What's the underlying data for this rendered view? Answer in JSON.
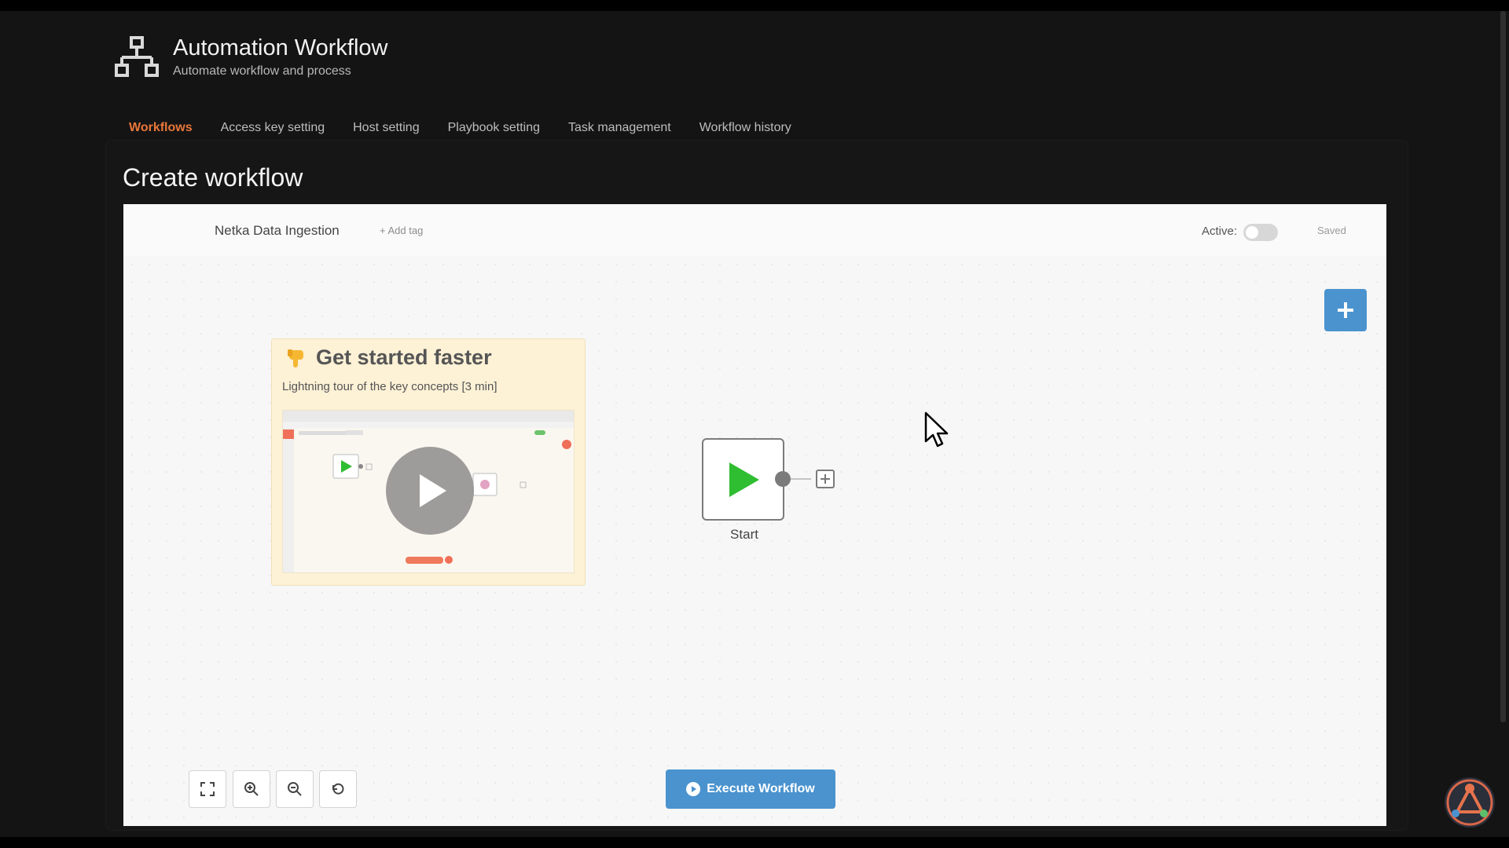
{
  "app": {
    "title": "Automation Workflow",
    "subtitle": "Automate workflow and process"
  },
  "tabs": [
    {
      "label": "Workflows",
      "active": true
    },
    {
      "label": "Access key setting",
      "active": false
    },
    {
      "label": "Host setting",
      "active": false
    },
    {
      "label": "Playbook setting",
      "active": false
    },
    {
      "label": "Task management",
      "active": false
    },
    {
      "label": "Workflow history",
      "active": false
    }
  ],
  "page": {
    "title": "Create workflow"
  },
  "editor": {
    "workflow_name": "Netka Data Ingestion",
    "add_tag": "+ Add tag",
    "active_label": "Active:",
    "active_on": false,
    "status": "Saved",
    "sticky": {
      "title": "Get started faster",
      "subtitle": "Lightning tour of the key concepts [3 min]"
    },
    "start_node": {
      "label": "Start"
    },
    "execute_button": "Execute Workflow"
  },
  "colors": {
    "accent_tab": "#e8773a",
    "primary_button": "#4a93cf",
    "start_play": "#2fbd32"
  },
  "icons": {
    "app": "sitemap-icon",
    "fit": "fullscreen-icon",
    "zoom_in": "zoom-in-icon",
    "zoom_out": "zoom-out-icon",
    "reset": "undo-icon"
  }
}
